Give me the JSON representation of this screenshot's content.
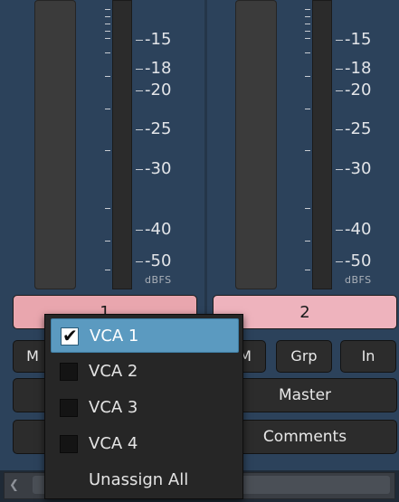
{
  "strips": [
    {
      "name": "1",
      "name_color": "#e9a6ae",
      "scale": [
        "-15",
        "-18",
        "-20",
        "-25",
        "-30",
        "-40",
        "-50"
      ],
      "unit": "dBFS",
      "buttons": [
        "M"
      ]
    },
    {
      "name": "2",
      "name_color": "#eeb3bd",
      "scale": [
        "-15",
        "-18",
        "-20",
        "-25",
        "-30",
        "-40",
        "-50"
      ],
      "unit": "dBFS",
      "buttons": [
        "M",
        "Grp",
        "In"
      ],
      "master_label": "Master",
      "comments_label": "Comments"
    }
  ],
  "vca_menu": {
    "items": [
      {
        "label": "VCA 1",
        "checked": true,
        "highlighted": true
      },
      {
        "label": "VCA 2",
        "checked": false
      },
      {
        "label": "VCA 3",
        "checked": false
      },
      {
        "label": "VCA 4",
        "checked": false
      }
    ],
    "unassign_label": "Unassign All",
    "check_glyph": "✔"
  },
  "colors": {
    "mixer_background": "#2c425b",
    "menu_highlight": "#5b9ac0",
    "name_button_1": "#e9a6ae",
    "name_button_2": "#eeb3bd"
  }
}
